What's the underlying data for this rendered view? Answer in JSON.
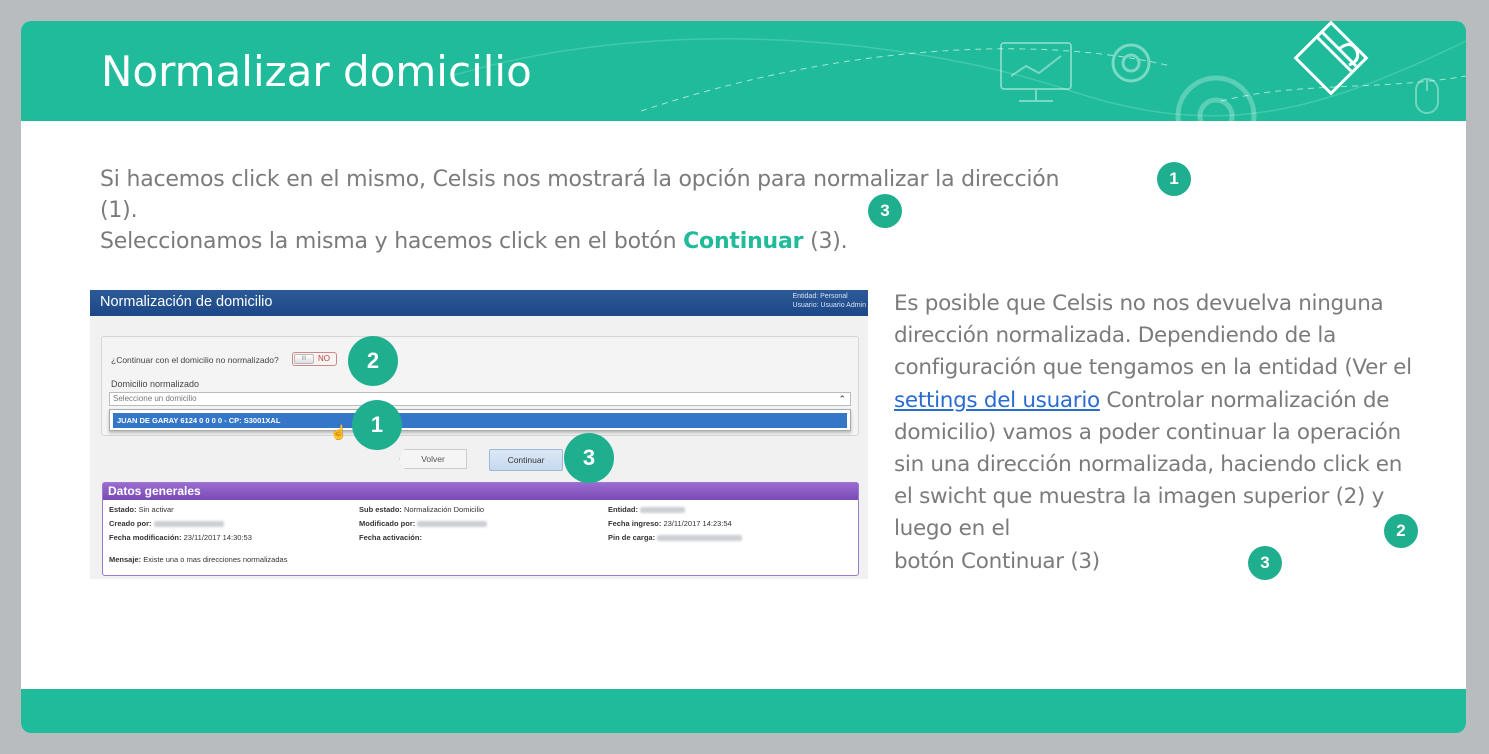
{
  "slide": {
    "title": "Normalizar domicilio",
    "intro_line1": "Si hacemos click en el mismo, Celsis nos mostrará la opción para normalizar la dirección (1).",
    "intro_line2_pre": "Seleccionamos la misma y hacemos click en el botón ",
    "intro_line2_bold": "Continuar",
    "intro_line2_post": " (3).",
    "badge_1": "1",
    "badge_2": "2",
    "badge_3": "3"
  },
  "side_text": {
    "part1": "Es posible que Celsis no nos devuelva ninguna dirección normalizada. Dependiendo de la configuración que tengamos en la entidad (Ver el ",
    "link": "settings del usuario",
    "part2": " Controlar normalización de domicilio) vamos a poder continuar la operación sin una dirección normalizada, haciendo click en el swicht que muestra la imagen superior (2) y luego en el",
    "part3": "botón Continuar (3)"
  },
  "screenshot": {
    "title": "Normalización de domicilio",
    "meta_entidad": "Entidad: Personal",
    "meta_usuario": "Usuario: Usuario Admin",
    "question": "¿Continuar con el domicilio no normalizado?",
    "toggle_knob": "III",
    "toggle_value": "NO",
    "field_label": "Domicilio normalizado",
    "select_placeholder": "Seleccione un domicilio",
    "option": "JUAN DE GARAY 6124 0 0 0 0 - CP: S3001XAL",
    "volver": "Volver",
    "continuar": "Continuar",
    "datos_title": "Datos generales",
    "estado_label": "Estado:",
    "estado_value": "Sin activar",
    "sub_estado_label": "Sub estado:",
    "sub_estado_value": "Normalización Domicilio",
    "entidad_label": "Entidad:",
    "creado_label": "Creado por:",
    "modificado_label": "Modificado por:",
    "fecha_ingreso_label": "Fecha ingreso:",
    "fecha_ingreso_value": "23/11/2017 14:23:54",
    "fecha_mod_label": "Fecha modificación:",
    "fecha_mod_value": "23/11/2017 14:30:53",
    "fecha_act_label": "Fecha activación:",
    "pin_label": "Pin de carga:",
    "mensaje_label": "Mensaje:",
    "mensaje_value": "Existe una o mas direcciones normalizadas"
  },
  "colors": {
    "accent": "#1fbb9a",
    "badge": "#1fae8e",
    "text": "#7b7b7b",
    "link": "#2a6bd0",
    "screenshot_header": "#1d4787",
    "datos_header": "#7a4bb5"
  }
}
